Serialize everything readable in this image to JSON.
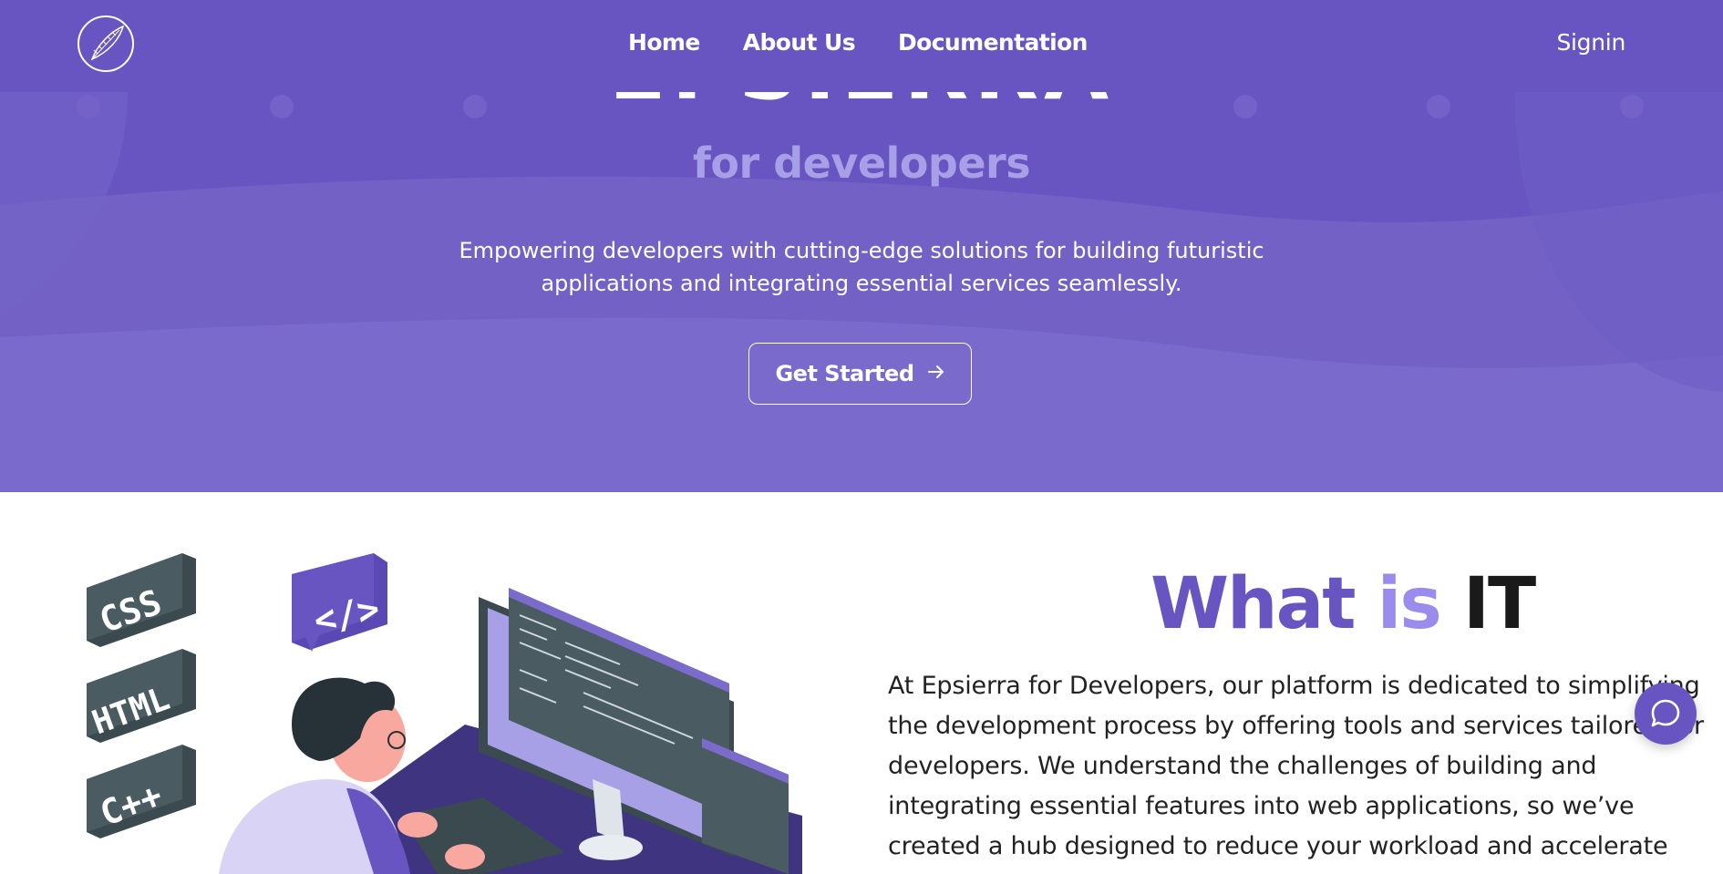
{
  "navbar": {
    "logo_icon": "feather-logo-icon",
    "links": [
      {
        "label": "Home"
      },
      {
        "label": "About Us"
      },
      {
        "label": "Documentation"
      }
    ],
    "signin_label": "Signin"
  },
  "hero": {
    "title": "EPSIERRA",
    "subtitle": "for developers",
    "description": "Empowering developers with cutting-edge solutions for building futuristic applications and integrating essential services seamlessly.",
    "cta_label": "Get Started",
    "cta_icon": "arrow-right-icon"
  },
  "about": {
    "title_part1": "What",
    "title_part2": "is",
    "title_part3": "IT",
    "body": "At Epsierra for Developers, our platform is dedicated to simplifying the development process by offering tools and services tailored for developers. We understand the challenges of building and integrating essential features into web applications, so we’ve created a hub designed to reduce your workload and accelerate",
    "illustration": {
      "badges": [
        "CSS",
        "HTML",
        "C++"
      ],
      "code_bubble": "</>"
    }
  },
  "chat": {
    "icon": "chat-bubble-icon"
  },
  "colors": {
    "primary": "#6855c2",
    "secondary": "#9a8cec",
    "white": "#ffffff",
    "text": "#222222"
  }
}
